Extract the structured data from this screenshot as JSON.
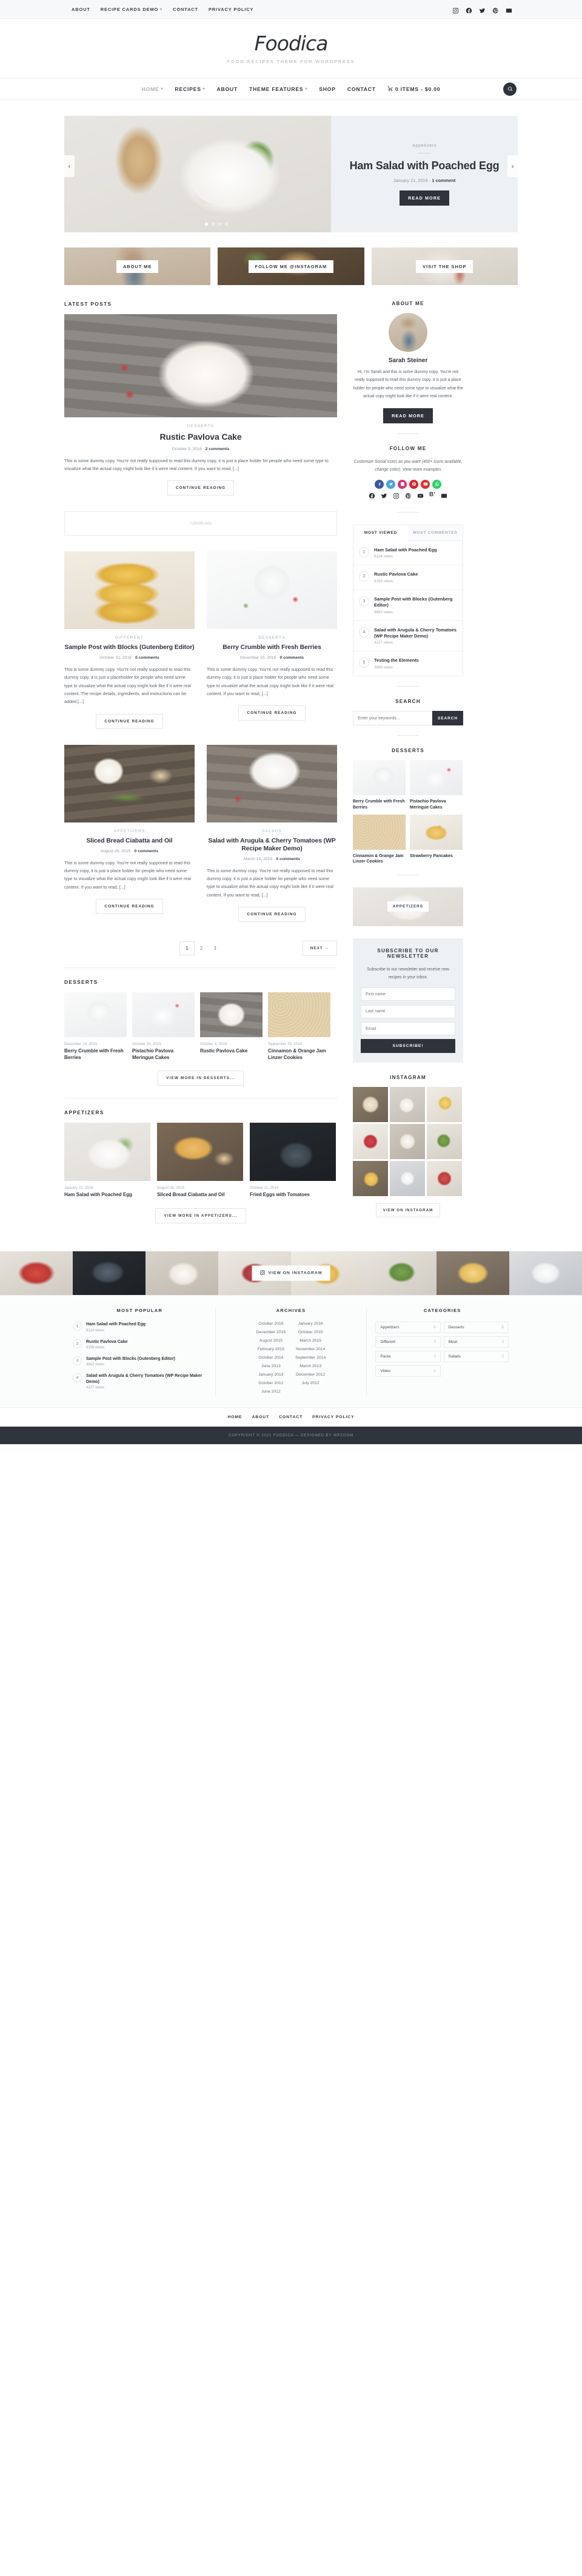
{
  "topbar": {
    "nav": [
      {
        "label": "ABOUT",
        "caret": false
      },
      {
        "label": "RECIPE CARDS DEMO",
        "caret": true
      },
      {
        "label": "CONTACT",
        "caret": false
      },
      {
        "label": "PRIVACY POLICY",
        "caret": false
      }
    ],
    "social": [
      "instagram-icon",
      "facebook-icon",
      "twitter-icon",
      "pinterest-icon",
      "email-icon"
    ]
  },
  "brand": {
    "logo": "Foodica",
    "tagline": "FOOD RECIPES THEME FOR WORDPRESS"
  },
  "mainnav": {
    "items": [
      {
        "label": "HOME",
        "caret": true,
        "active": true
      },
      {
        "label": "RECIPES",
        "caret": true,
        "active": false
      },
      {
        "label": "ABOUT",
        "caret": false,
        "active": false
      },
      {
        "label": "THEME FEATURES",
        "caret": true,
        "active": false
      },
      {
        "label": "SHOP",
        "caret": false,
        "active": false
      },
      {
        "label": "CONTACT",
        "caret": false,
        "active": false
      }
    ],
    "cart": "0 ITEMS - $0.00",
    "search_icon": "search-icon"
  },
  "slider": {
    "category": "Appetizers",
    "title": "Ham Salad with Poached Egg",
    "date": "January 21, 2016",
    "comments": "1 comment",
    "button": "READ MORE",
    "dots": 4,
    "active_dot": 1,
    "prev": "‹",
    "next": "›"
  },
  "promos": [
    {
      "label": "ABOUT ME"
    },
    {
      "label": "FOLLOW ME @INSTAGRAM"
    },
    {
      "label": "VISIT THE SHOP"
    }
  ],
  "content": {
    "latest_heading": "LATEST POSTS",
    "featured": {
      "category": "DESSERTS",
      "title": "Rustic Pavlova Cake",
      "date": "October 3, 2014",
      "comments": "2 comments",
      "excerpt": "This is some dummy copy. You're not really supposed to read this dummy copy, it is just a place holder for people who need some type to visualize what the actual copy might look like if it were real content. If you want to read, [...]",
      "button": "CONTINUE READING"
    },
    "ad_label": "728x90 Ads",
    "grid_row1": [
      {
        "category": "DIFFERENT",
        "title": "Sample Post with Blocks (Gutenberg Editor)",
        "date": "October 31, 2018",
        "comments": "0 comments",
        "excerpt": "This is some dummy copy. You're not really supposed to read this dummy copy, it is just a placeholder for people who need some type to visualize what the actual copy might look like if it were real content. The recipe details, ingredients, and instructions can be added [...]",
        "button": "CONTINUE READING"
      },
      {
        "category": "DESSERTS",
        "title": "Berry Crumble with Fresh Berries",
        "date": "December 10, 2015",
        "comments": "0 comments",
        "excerpt": "This is some dummy copy. You're not really supposed to read this dummy copy, it is just a place holder for people who need some type to visualize what the actual copy might look like if it were real content. If you want to read, [...]",
        "button": "CONTINUE READING"
      }
    ],
    "grid_row2": [
      {
        "category": "APPETIZERS",
        "title": "Sliced Bread Ciabatta and Oil",
        "date": "August 26, 2015",
        "comments": "0 comments",
        "excerpt": "This is some dummy copy. You're not really supposed to read this dummy copy, it is just a place holder for people who need some type to visualize what the actual copy might look like if it were real content. If you want to read, [...]",
        "button": "CONTINUE READING"
      },
      {
        "category": "SALADS",
        "title": "Salad with Arugula & Cherry Tomatoes (WP Recipe Maker Demo)",
        "date": "March 15, 2015",
        "comments": "0 comments",
        "excerpt": "This is some dummy copy. You're not really supposed to read this dummy copy, it is just a place holder for people who need some type to visualize what the actual copy might look like if it were real content. If you want to read, [...]",
        "button": "CONTINUE READING"
      }
    ],
    "pagination": {
      "pages": [
        "1",
        "2",
        "3"
      ],
      "current": "1",
      "next": "NEXT →"
    },
    "desserts": {
      "heading": "DESSERTS",
      "items": [
        {
          "date": "December 10, 2015",
          "title": "Berry Crumble with Fresh Berries"
        },
        {
          "date": "October 23, 2015",
          "title": "Pistachio Pavlova Meringue Cakes"
        },
        {
          "date": "October 3, 2014",
          "title": "Rustic Pavlova Cake"
        },
        {
          "date": "September 25, 2014",
          "title": "Cinnamon & Orange Jam Linzer Cookies"
        }
      ],
      "more": "VIEW MORE IN DESSERTS..."
    },
    "appetizers": {
      "heading": "APPETIZERS",
      "items": [
        {
          "date": "January 21, 2016",
          "title": "Ham Salad with Poached Egg"
        },
        {
          "date": "August 26, 2015",
          "title": "Sliced Bread Ciabatta and Oil"
        },
        {
          "date": "October 11, 2014",
          "title": "Fried Eggs with Tomatoes"
        }
      ],
      "more": "VIEW MORE IN APPETIZERS..."
    }
  },
  "sidebar": {
    "about": {
      "title": "ABOUT ME",
      "name": "Sarah Steiner",
      "text": "Hi, I'm Sarah and this is some dummy copy. You're not really supposed to read this dummy copy, it is just a place holder for people who need some type to visualize what the actual copy might look like if it were real content.",
      "button": "READ MORE"
    },
    "follow": {
      "title": "FOLLOW ME",
      "text": "Customize Social Icons as you want (400+ icons available, change color). View more examples",
      "round_icons": [
        "facebook-icon",
        "twitter-icon",
        "instagram-icon",
        "pinterest-icon",
        "youtube-icon",
        "whatsapp-icon"
      ],
      "flat_icons": [
        "facebook-icon",
        "twitter-icon",
        "instagram-icon",
        "pinterest-icon",
        "youtube-icon",
        "bloglovin-icon",
        "email-icon"
      ]
    },
    "tabs": {
      "most_viewed": "MOST VIEWED",
      "most_commented": "MOST COMMENTED",
      "items": [
        {
          "rank": "1",
          "title": "Ham Salad with Poached Egg",
          "views": "8124 views"
        },
        {
          "rank": "2",
          "title": "Rustic Pavlova Cake",
          "views": "6159 views"
        },
        {
          "rank": "3",
          "title": "Sample Post with Blocks (Gutenberg Editor)",
          "views": "4882 views"
        },
        {
          "rank": "4",
          "title": "Salad with Arugula & Cherry Tomatoes (WP Recipe Maker Demo)",
          "views": "4227 views"
        },
        {
          "rank": "5",
          "title": "Testing the Elements",
          "views": "3668 views"
        }
      ]
    },
    "search": {
      "title": "SEARCH",
      "placeholder": "Enter your keywords...",
      "button": "SEARCH"
    },
    "desserts": {
      "title": "DESSERTS",
      "items": [
        {
          "title": "Berry Crumble with Fresh Berries"
        },
        {
          "title": "Pistachio Pavlova Meringue Cakes"
        },
        {
          "title": "Cinnamon & Orange Jam Linzer Cookies"
        },
        {
          "title": "Strawberry Pancakes"
        }
      ]
    },
    "banner": {
      "label": "APPETIZERS"
    },
    "newsletter": {
      "title": "SUBSCRIBE TO OUR NEWSLETTER",
      "text": "Subscribe to our newsletter and receive new recipes in your inbox.",
      "first_name": "First name",
      "last_name": "Last name",
      "email": "Email",
      "button": "SUBSCRIBE!"
    },
    "instagram": {
      "title": "INSTAGRAM",
      "link": "VIEW ON INSTAGRAM",
      "count": 9
    }
  },
  "ig_strip": {
    "badge": "VIEW ON INSTAGRAM",
    "icon": "instagram-icon",
    "count": 8
  },
  "footer": {
    "most_popular": {
      "title": "MOST POPULAR",
      "items": [
        {
          "rank": "1",
          "title": "Ham Salad with Poached Egg",
          "views": "8124 views"
        },
        {
          "rank": "2",
          "title": "Rustic Pavlova Cake",
          "views": "6159 views"
        },
        {
          "rank": "3",
          "title": "Sample Post with Blocks (Gutenberg Editor)",
          "views": "4882 views"
        },
        {
          "rank": "4",
          "title": "Salad with Arugula & Cherry Tomatoes (WP Recipe Maker Demo)",
          "views": "4227 views"
        }
      ]
    },
    "archives": {
      "title": "ARCHIVES",
      "col1": [
        "October 2018",
        "December 2015",
        "August 2015",
        "February 2015",
        "October 2014",
        "June 2013",
        "January 2013",
        "October 2012",
        "June 2012"
      ],
      "col2": [
        "January 2016",
        "October 2015",
        "March 2015",
        "November 2014",
        "September 2014",
        "March 2013",
        "December 2012",
        "July 2012"
      ]
    },
    "categories": {
      "title": "CATEGORIES",
      "items": [
        {
          "name": "Appetizers",
          "count": "5"
        },
        {
          "name": "Desserts",
          "count": "6"
        },
        {
          "name": "Different",
          "count": "3"
        },
        {
          "name": "Meat",
          "count": "3"
        },
        {
          "name": "Pasta",
          "count": "3"
        },
        {
          "name": "Salads",
          "count": "2"
        },
        {
          "name": "Video",
          "count": "2"
        }
      ]
    },
    "nav": [
      "HOME",
      "ABOUT",
      "CONTACT",
      "PRIVACY POLICY"
    ],
    "copyright": "COPYRIGHT © 2021 FOODICA — DESIGNED BY WPZOOM"
  }
}
